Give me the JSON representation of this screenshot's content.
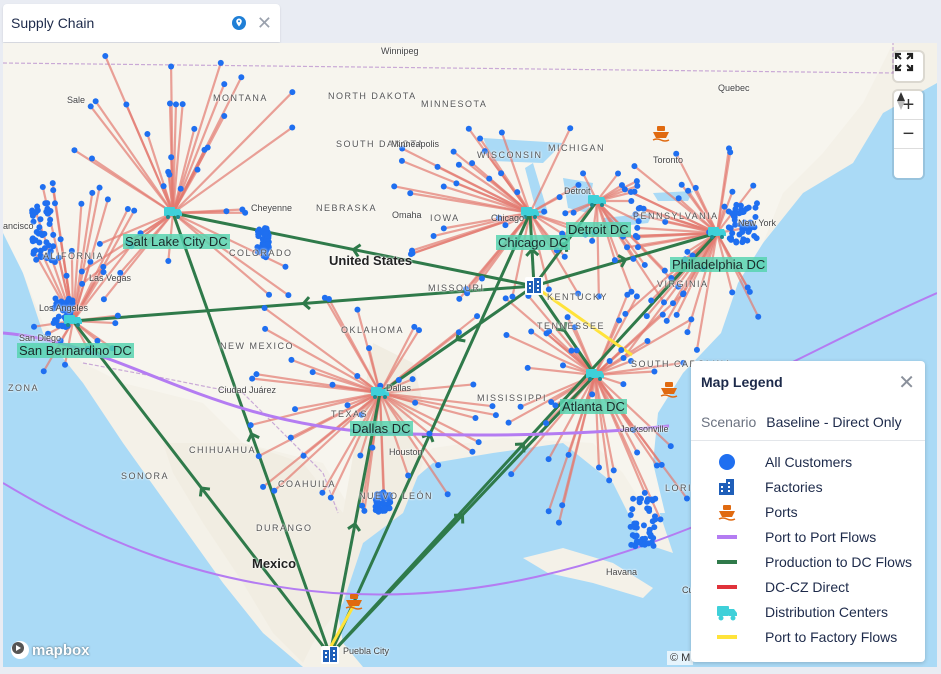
{
  "tab": {
    "title": "Supply Chain",
    "colors": {
      "pin": "#1f7fd6"
    }
  },
  "map": {
    "colors": {
      "water": "#aadaf6",
      "land": "#f4f1e8",
      "land_us": "#f7f5ee",
      "border": "#c9a9d6",
      "customer": "#1f6ff0",
      "dc_customer_flow": "#e37a70",
      "production_flow": "#2f7a4a",
      "port_flow": "#b47cf2",
      "port_factory_flow": "#ffe33a",
      "dc": "#3fd0d9",
      "factory": "#1f5fb9",
      "port": "#e06a10"
    },
    "places": [
      {
        "name": "Winnipeg",
        "cls": "small"
      },
      {
        "name": "MONTANA",
        "cls": "state"
      },
      {
        "name": "NORTH DAKOTA",
        "cls": "state"
      },
      {
        "name": "MINNESOTA",
        "cls": "state"
      },
      {
        "name": "SOUTH DAKOTA",
        "cls": "state"
      },
      {
        "name": "Minneapolis",
        "cls": "small"
      },
      {
        "name": "WISCONSIN",
        "cls": "state"
      },
      {
        "name": "MICHIGAN",
        "cls": "state"
      },
      {
        "name": "Quebec",
        "cls": "small"
      },
      {
        "name": "Toronto",
        "cls": "small"
      },
      {
        "name": "Detroit",
        "cls": "small"
      },
      {
        "name": "New York",
        "cls": "small"
      },
      {
        "name": "Cheyenne",
        "cls": "small"
      },
      {
        "name": "NEBRASKA",
        "cls": "state"
      },
      {
        "name": "Omaha",
        "cls": "small"
      },
      {
        "name": "IOWA",
        "cls": "state"
      },
      {
        "name": "Chicago",
        "cls": "small"
      },
      {
        "name": "PENNSYLVANIA",
        "cls": "state"
      },
      {
        "name": "United States",
        "cls": "country"
      },
      {
        "name": "Las Vegas",
        "cls": "small"
      },
      {
        "name": "COLORADO",
        "cls": "state"
      },
      {
        "name": "MISSOURI",
        "cls": "state"
      },
      {
        "name": "KENTUCKY",
        "cls": "state"
      },
      {
        "name": "VIRGINIA",
        "cls": "state"
      },
      {
        "name": "Los Angeles",
        "cls": "small"
      },
      {
        "name": "San Diego",
        "cls": "small"
      },
      {
        "name": "OKLAHOMA",
        "cls": "state"
      },
      {
        "name": "TENNESSEE",
        "cls": "state"
      },
      {
        "name": "NEW MEXICO",
        "cls": "state"
      },
      {
        "name": "Ciudad Juárez",
        "cls": "small"
      },
      {
        "name": "Dallas",
        "cls": "small"
      },
      {
        "name": "TEXAS",
        "cls": "state"
      },
      {
        "name": "MISSISSIPPI",
        "cls": "state"
      },
      {
        "name": "SOUTH CAROLINA",
        "cls": "state"
      },
      {
        "name": "Houston",
        "cls": "small"
      },
      {
        "name": "Jacksonville",
        "cls": "small"
      },
      {
        "name": "CHIHUAHUA",
        "cls": "state"
      },
      {
        "name": "SONORA",
        "cls": "state"
      },
      {
        "name": "COAHUILA",
        "cls": "state"
      },
      {
        "name": "NUEVO LEÓN",
        "cls": "state"
      },
      {
        "name": "DURANGO",
        "cls": "state"
      },
      {
        "name": "Mexico",
        "cls": "country"
      },
      {
        "name": "Havana",
        "cls": "small"
      },
      {
        "name": "Puebla City",
        "cls": "small"
      },
      {
        "name": "ALIFORNIA",
        "cls": "state"
      },
      {
        "name": "ancisco",
        "cls": "small"
      },
      {
        "name": "Sale",
        "cls": "small"
      },
      {
        "name": "ZONA",
        "cls": "state"
      },
      {
        "name": "LORIDA",
        "cls": "state"
      },
      {
        "name": "Cu",
        "cls": "small"
      }
    ],
    "dcs": [
      {
        "name": "Salt Lake City DC"
      },
      {
        "name": "San Bernardino DC"
      },
      {
        "name": "Dallas DC"
      },
      {
        "name": "Chicago DC"
      },
      {
        "name": "Detroit DC"
      },
      {
        "name": "Philadelphia DC"
      },
      {
        "name": "Atlanta DC"
      }
    ],
    "controls": {
      "fullscreen_icon": "fullscreen-icon",
      "zoom_in": "+",
      "zoom_out": "−",
      "compass_icon": "compass-icon"
    },
    "logo": "mapbox",
    "attribution": "© M"
  },
  "legend": {
    "title": "Map Legend",
    "scenario_label": "Scenario",
    "scenario_value": "Baseline - Direct Only",
    "items": [
      {
        "label": "All Customers",
        "icon": "circle"
      },
      {
        "label": "Factories",
        "icon": "factory"
      },
      {
        "label": "Ports",
        "icon": "ship"
      },
      {
        "label": "Port to Port Flows",
        "icon": "line",
        "color": "#b47cf2"
      },
      {
        "label": "Production to DC Flows",
        "icon": "line",
        "color": "#2f7a4a"
      },
      {
        "label": "DC-CZ Direct",
        "icon": "line",
        "color": "#e0323a"
      },
      {
        "label": "Distribution Centers",
        "icon": "truck"
      },
      {
        "label": "Port to Factory Flows",
        "icon": "line",
        "color": "#ffe33a"
      }
    ]
  }
}
